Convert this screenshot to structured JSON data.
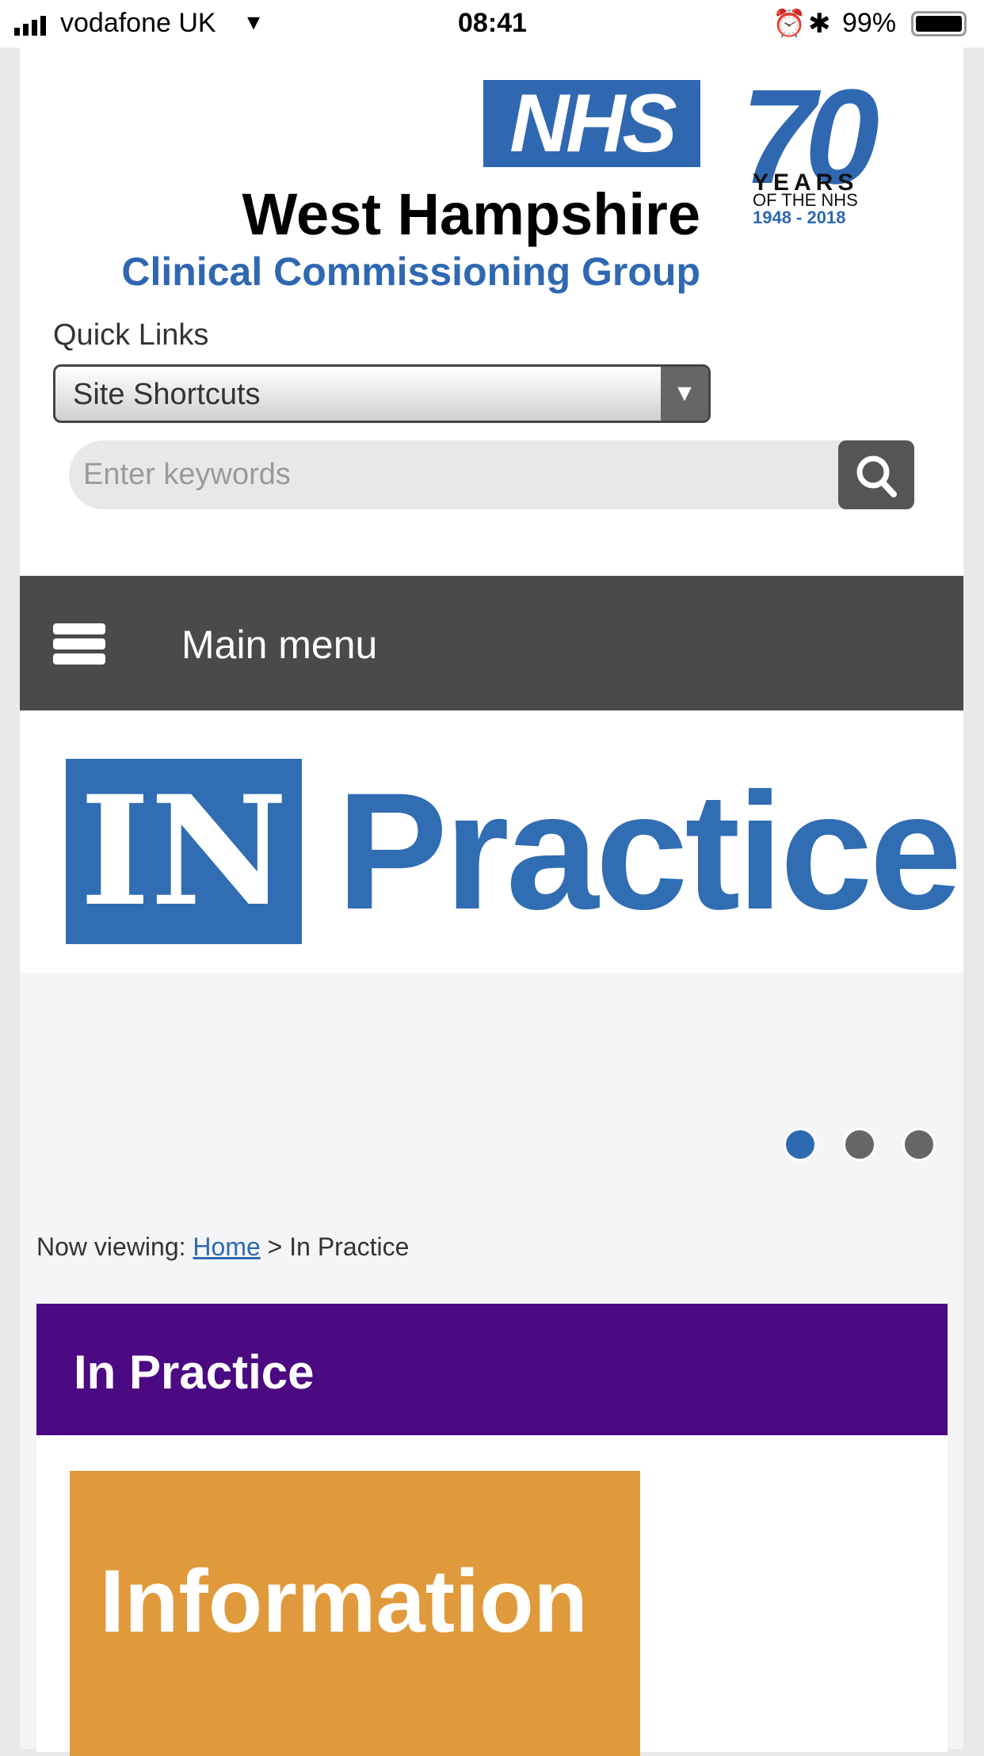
{
  "status_bar": {
    "carrier": "vodafone UK",
    "time": "08:41",
    "battery": "99%"
  },
  "logo": {
    "nhs": "NHS",
    "seventy": "70",
    "years": "YEARS",
    "of_the_nhs": "OF THE NHS",
    "year_range": "1948 - 2018",
    "org_name": "West Hampshire",
    "org_sub": "Clinical Commissioning Group"
  },
  "quick_links": {
    "label": "Quick Links",
    "select_value": "Site Shortcuts"
  },
  "search": {
    "placeholder": "Enter keywords"
  },
  "menu": {
    "label": "Main menu"
  },
  "banner": {
    "in": "IN",
    "practice": "Practice"
  },
  "carousel": {
    "active_index": 0,
    "count": 3
  },
  "breadcrumb": {
    "prefix": "Now viewing:",
    "home": "Home",
    "separator": ">",
    "current": "In Practice"
  },
  "section": {
    "title": "In Practice",
    "image_text": "Information"
  }
}
